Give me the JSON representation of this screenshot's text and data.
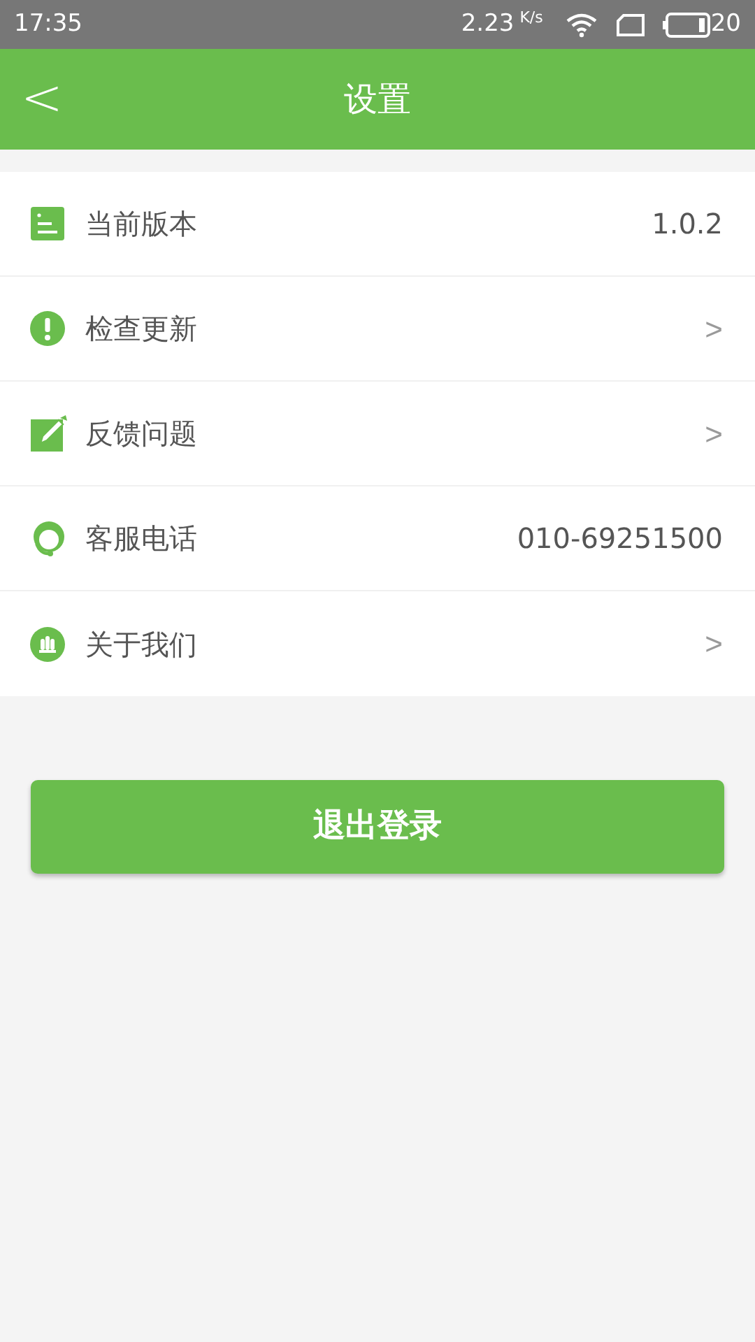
{
  "status_bar": {
    "time": "17:35",
    "speed": "2.23",
    "speed_unit": "K/s",
    "battery": "20"
  },
  "header": {
    "back": "<",
    "title": "设置"
  },
  "items": [
    {
      "label": "当前版本",
      "kind": "value",
      "trailing": "1.0.2"
    },
    {
      "label": "检查更新",
      "kind": "link",
      "trailing": ">"
    },
    {
      "label": "反馈问题",
      "kind": "link",
      "trailing": ">"
    },
    {
      "label": "客服电话",
      "kind": "value",
      "trailing": "010-69251500"
    },
    {
      "label": "关于我们",
      "kind": "link",
      "trailing": ">"
    }
  ],
  "logout_button": "退出登录"
}
